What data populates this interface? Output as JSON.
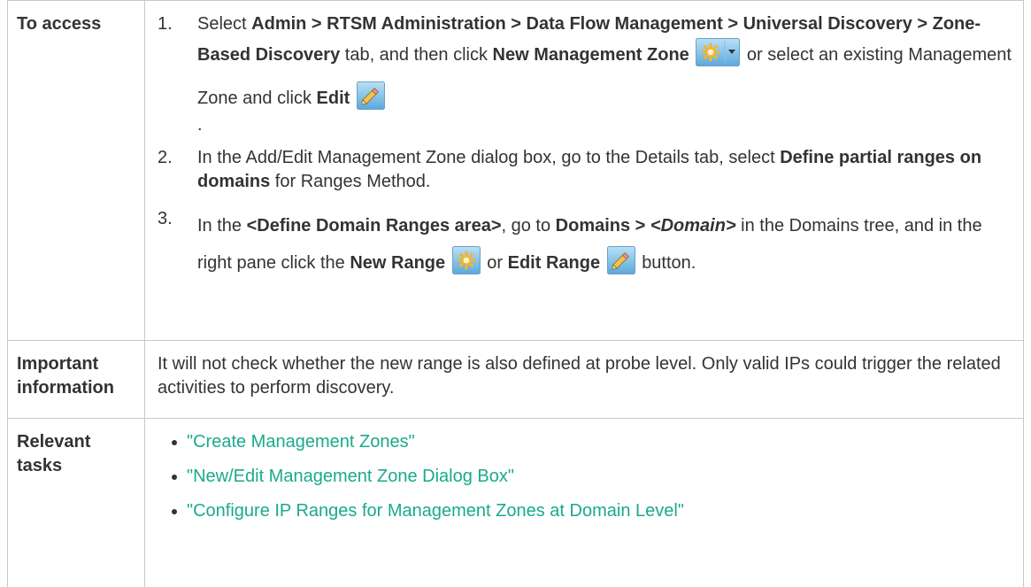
{
  "rows": {
    "access": {
      "header": "To access",
      "step1": {
        "number": "1.",
        "t1": "Select ",
        "b1": "Admin > RTSM Administration > Data Flow Management > Universal Discovery > Zone-Based Discovery",
        "t2": " tab, and then click ",
        "b2": "New Management Zone",
        "icon1": "new-star-dropdown-icon",
        "t3": " or select an existing Management Zone and click ",
        "b3": "Edit",
        "icon2": "edit-pencil-icon",
        "t4": "."
      },
      "step2": {
        "number": "2.",
        "t1": "In the Add/Edit Management Zone dialog box, go to the Details tab, select ",
        "b1": "Define partial ranges on domains",
        "t2": " for Ranges Method."
      },
      "step3": {
        "number": "3.",
        "t1": "In the ",
        "b1": "<Define Domain Ranges area>",
        "t2": ", go to ",
        "b2": "Domains > ",
        "bi1": "<Domain>",
        "t3": " in the Domains tree, and in the right pane click the ",
        "b3": "New Range",
        "icon1": "new-star-icon",
        "t4": " or ",
        "b4": "Edit Range",
        "icon2": "edit-pencil-icon",
        "t5": " button."
      }
    },
    "important": {
      "header": "Important information",
      "text": "It will not check whether the new range is also defined at probe level. Only valid IPs could trigger the related activities to perform discovery."
    },
    "relevant": {
      "header": "Relevant tasks",
      "links": [
        "\"Create Management Zones\"",
        "\"New/Edit Management Zone Dialog Box\"",
        "\"Configure IP Ranges for Management Zones at Domain Level\""
      ]
    }
  },
  "colors": {
    "link": "#19aa8c",
    "border": "#c8c8c8",
    "text": "#333333"
  }
}
